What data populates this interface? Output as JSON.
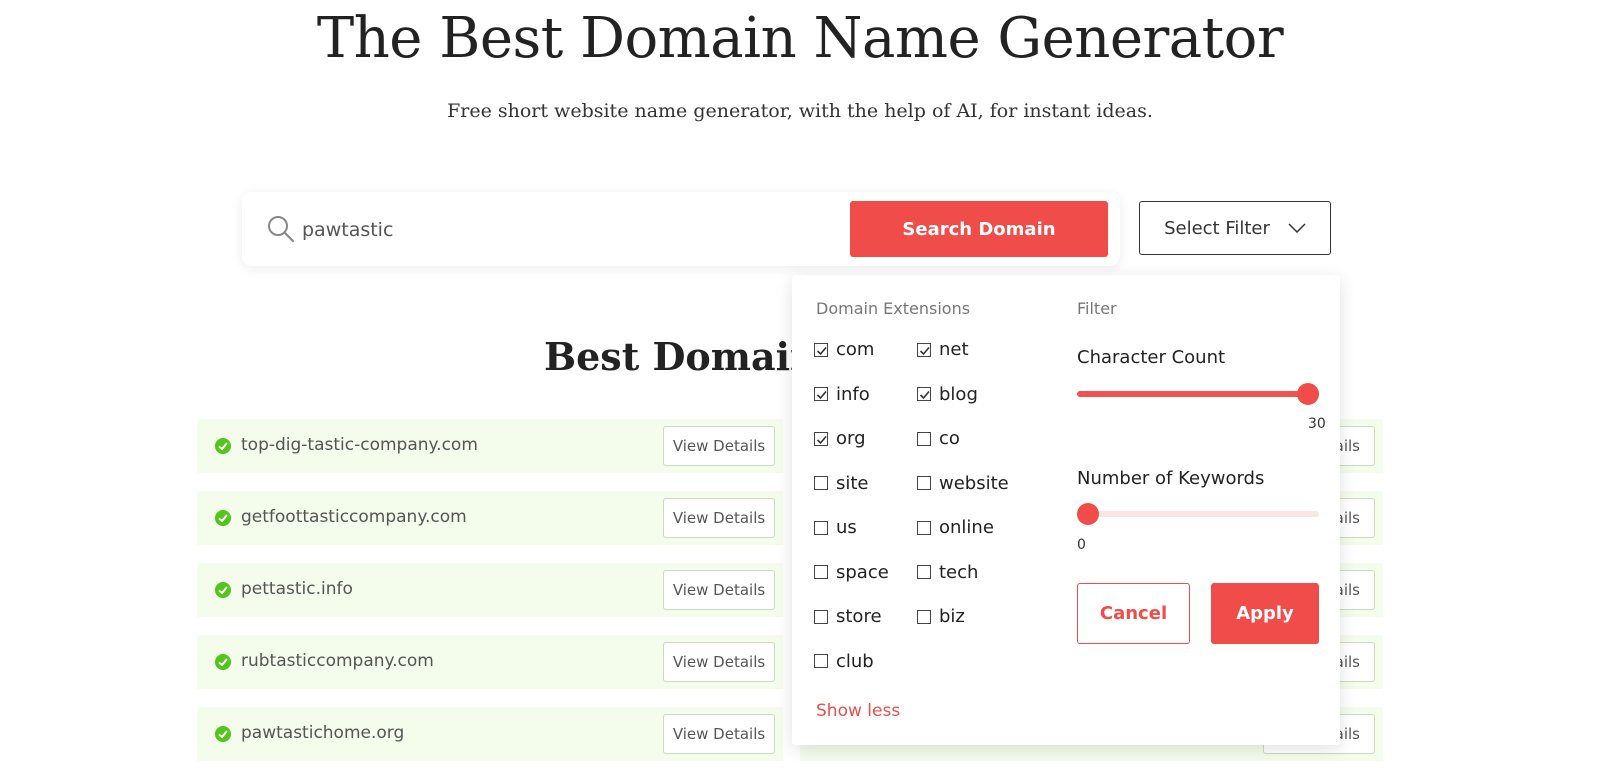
{
  "header": {
    "title": "The Best Domain Name Generator",
    "subtitle": "Free short website name generator, with the help of AI, for instant ideas."
  },
  "search": {
    "value": "pawtastic",
    "button_label": "Search Domain",
    "filter_label": "Select Filter"
  },
  "results": {
    "section_title": "Best Domains",
    "view_label": "View Details",
    "right_view_label": "ails",
    "items": [
      {
        "domain": "top-dig-tastic-company.com"
      },
      {
        "domain": "getfoottasticcompany.com"
      },
      {
        "domain": "pettastic.info"
      },
      {
        "domain": "rubtasticcompany.com"
      },
      {
        "domain": "pawtastichome.org"
      }
    ]
  },
  "filter_panel": {
    "extensions_heading": "Domain Extensions",
    "filter_heading": "Filter",
    "extensions": [
      {
        "label": "com",
        "checked": true
      },
      {
        "label": "net",
        "checked": true
      },
      {
        "label": "info",
        "checked": true
      },
      {
        "label": "blog",
        "checked": true
      },
      {
        "label": "org",
        "checked": true
      },
      {
        "label": "co",
        "checked": false
      },
      {
        "label": "site",
        "checked": false
      },
      {
        "label": "website",
        "checked": false
      },
      {
        "label": "us",
        "checked": false
      },
      {
        "label": "online",
        "checked": false
      },
      {
        "label": "space",
        "checked": false
      },
      {
        "label": "tech",
        "checked": false
      },
      {
        "label": "store",
        "checked": false
      },
      {
        "label": "biz",
        "checked": false
      },
      {
        "label": "club",
        "checked": false
      }
    ],
    "show_less": "Show less",
    "character_count": {
      "label": "Character Count",
      "value": 30,
      "min": 0,
      "max": 30
    },
    "keywords": {
      "label": "Number of Keywords",
      "value": 0,
      "min": 0,
      "max": 10
    },
    "cancel_label": "Cancel",
    "apply_label": "Apply"
  },
  "colors": {
    "accent": "#ef4c4a",
    "result_bg": "#f4fcec",
    "check": "#52c41a"
  }
}
